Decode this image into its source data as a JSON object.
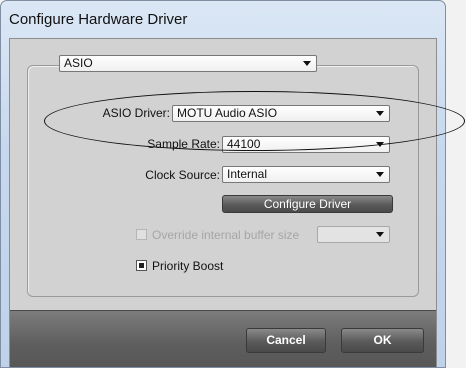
{
  "window": {
    "title": "Configure Hardware Driver"
  },
  "interface": {
    "selected": "ASIO"
  },
  "fields": {
    "asio_driver_label": "ASIO Driver:",
    "asio_driver_value": "MOTU Audio ASIO",
    "sample_rate_label": "Sample Rate:",
    "sample_rate_value": "44100",
    "clock_source_label": "Clock Source:",
    "clock_source_value": "Internal"
  },
  "buttons": {
    "configure_driver": "Configure Driver",
    "cancel": "Cancel",
    "ok": "OK"
  },
  "options": {
    "override_buffer_label": "Override internal buffer size",
    "override_buffer_checked": false,
    "override_buffer_value": "",
    "priority_boost_label": "Priority Boost",
    "priority_boost_checked": true
  },
  "annotation": {
    "shape": "ellipse",
    "highlights": "asio-driver-row"
  }
}
